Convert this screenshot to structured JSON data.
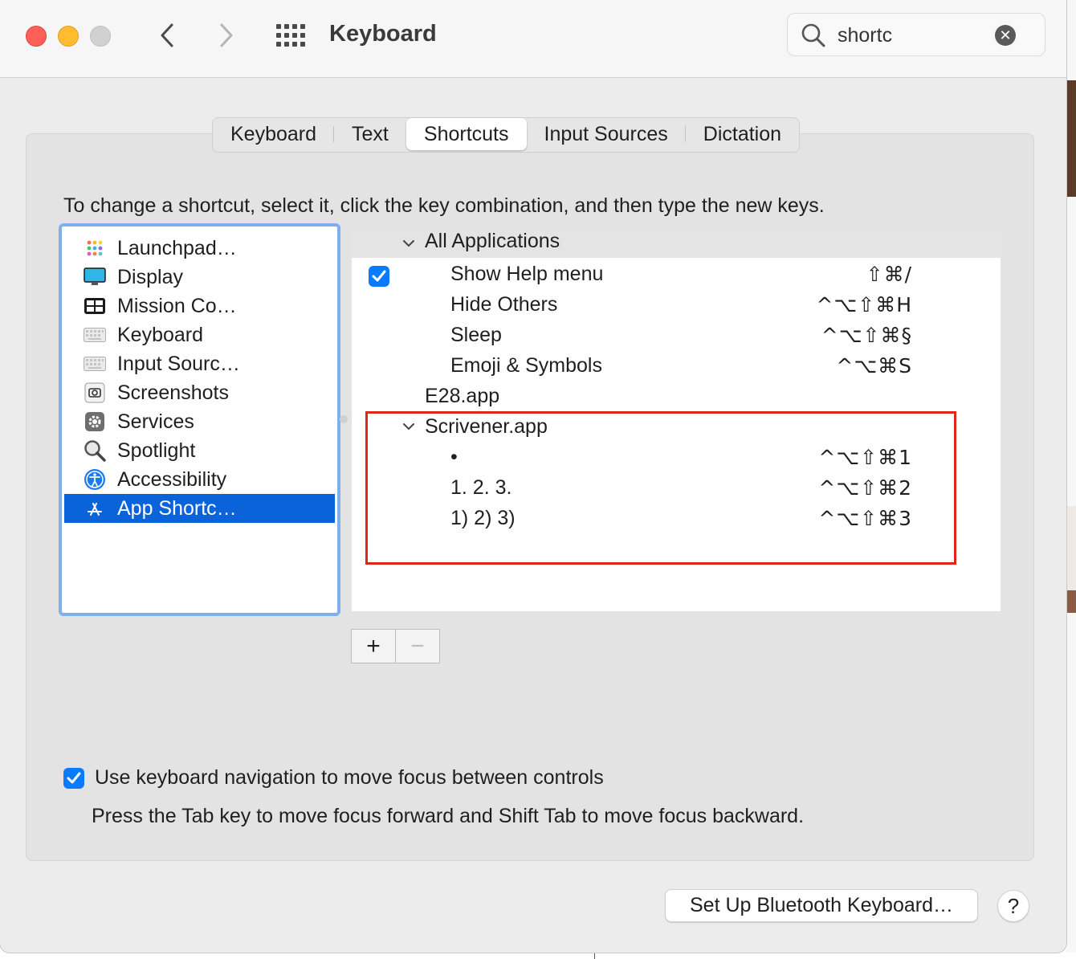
{
  "window": {
    "title": "Keyboard"
  },
  "search": {
    "value": "shortc"
  },
  "tabs": [
    "Keyboard",
    "Text",
    "Shortcuts",
    "Input Sources",
    "Dictation"
  ],
  "active_tab": "Shortcuts",
  "instruction": "To change a shortcut, select it, click the key combination, and then type the new keys.",
  "sidebar": {
    "items": [
      {
        "label": "Launchpad…",
        "icon": "launchpad-icon"
      },
      {
        "label": "Display",
        "icon": "display-icon"
      },
      {
        "label": "Mission Co…",
        "icon": "mission-control-icon"
      },
      {
        "label": "Keyboard",
        "icon": "keyboard-icon"
      },
      {
        "label": "Input Sourc…",
        "icon": "input-sources-icon"
      },
      {
        "label": "Screenshots",
        "icon": "screenshots-icon"
      },
      {
        "label": "Services",
        "icon": "services-gear-icon"
      },
      {
        "label": "Spotlight",
        "icon": "spotlight-magnifier-icon"
      },
      {
        "label": "Accessibility",
        "icon": "accessibility-icon"
      },
      {
        "label": "App Shortc…",
        "icon": "app-store-icon",
        "selected": true
      }
    ]
  },
  "shortcuts": {
    "all_apps": {
      "label": "All Applications",
      "items": [
        {
          "label": "Show Help menu",
          "keys": "⇧⌘/",
          "checked": true
        },
        {
          "label": "Hide Others",
          "keys": "^⌥⇧⌘H"
        },
        {
          "label": "Sleep",
          "keys": "^⌥⇧⌘§"
        },
        {
          "label": "Emoji & Symbols",
          "keys": "^⌥⌘S"
        }
      ]
    },
    "e28": {
      "label": "E28.app"
    },
    "scrivener": {
      "label": "Scrivener.app",
      "items": [
        {
          "label": "•",
          "keys": "^⌥⇧⌘1"
        },
        {
          "label": "1.  2.  3.",
          "keys": "^⌥⇧⌘2"
        },
        {
          "label": "1)  2)  3)",
          "keys": "^⌥⇧⌘3"
        }
      ]
    }
  },
  "buttons": {
    "add": "+",
    "remove": "−",
    "bluetooth": "Set Up Bluetooth Keyboard…",
    "help": "?"
  },
  "keyboard_nav": {
    "checked": true,
    "label": "Use keyboard navigation to move focus between controls",
    "help": "Press the Tab key to move focus forward and Shift Tab to move focus backward."
  },
  "colors": {
    "accent": "#0a63d8",
    "checkbox": "#0a7aff",
    "highlight_box": "#e0261b"
  }
}
